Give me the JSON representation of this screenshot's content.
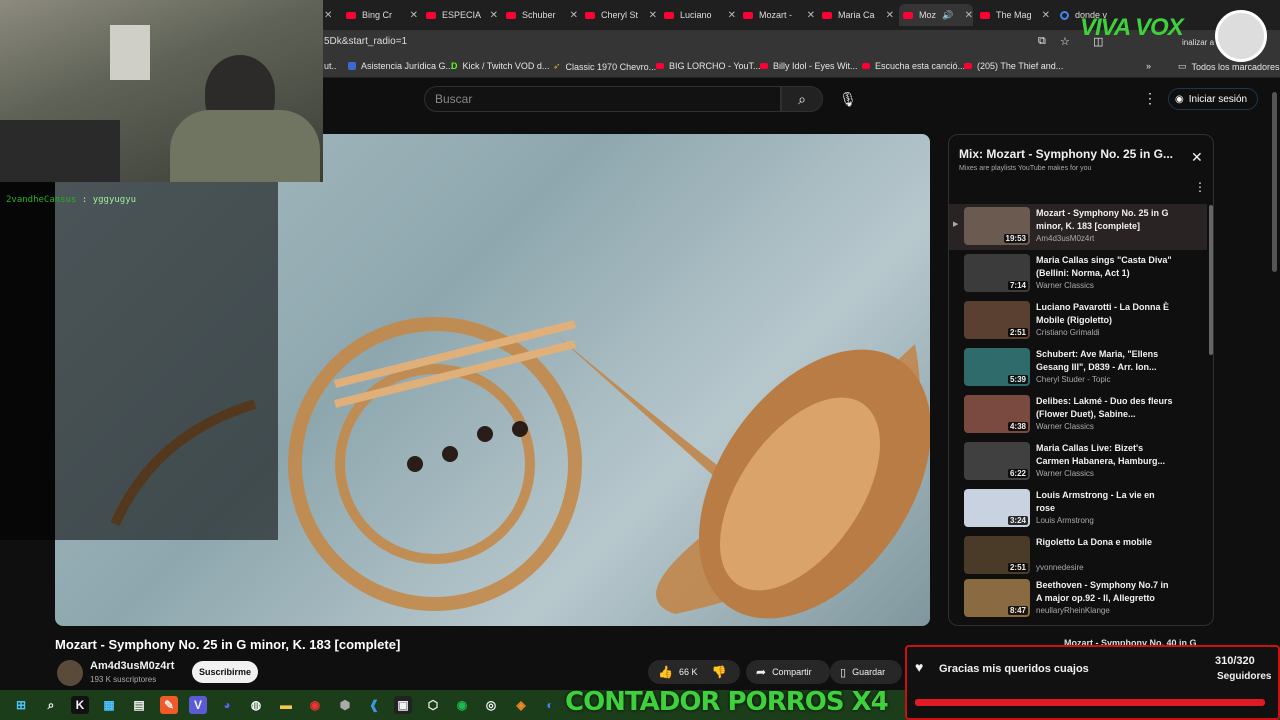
{
  "tabs": [
    {
      "label": "Bing Cr",
      "active": false
    },
    {
      "label": "ESPECIA",
      "active": false
    },
    {
      "label": "Schuber",
      "active": false
    },
    {
      "label": "Cheryl St",
      "active": false
    },
    {
      "label": "Luciano",
      "active": false
    },
    {
      "label": "Mozart -",
      "active": false
    },
    {
      "label": "Maria Ca",
      "active": false
    },
    {
      "label": "Moz",
      "active": true
    },
    {
      "label": "The Mag",
      "active": false
    },
    {
      "label": "donde v",
      "active": false
    }
  ],
  "url": "5Dk&start_radio=1",
  "bookmarks": [
    "ut..",
    "Asistencia Jurídica G...",
    "Kick / Twitch VOD d...",
    "Classic 1970 Chevro...",
    "BIG LORCHO - YouT...",
    "Billy Idol - Eyes Wit...",
    "Escucha esta canció...",
    "(205) The Thief and..."
  ],
  "all_bookmarks": "Todos los marcadores",
  "finalize": "inalizar a",
  "search": {
    "placeholder": "Buscar"
  },
  "signin_label": "Iniciar sesión",
  "video": {
    "title": "Mozart - Symphony No. 25 in G minor, K. 183 [complete]",
    "channel": "Am4d3usM0z4rt",
    "subscribers": "193 K suscriptores",
    "subscribe_label": "Suscribirme",
    "likes": "66 K",
    "share_label": "Compartir",
    "save_label": "Guardar"
  },
  "playlist": {
    "title": "Mix: Mozart - Symphony No. 25 in G...",
    "subtitle": "Mixes are playlists YouTube makes for you",
    "items": [
      {
        "title": "Mozart - Symphony No. 25 in G minor, K. 183 [complete]",
        "channel": "Am4d3usM0z4rt",
        "duration": "19:53"
      },
      {
        "title": "Maria Callas sings \"Casta Diva\" (Bellini: Norma, Act 1)",
        "channel": "Warner Classics",
        "duration": "7:14"
      },
      {
        "title": "Luciano Pavarotti - La Donna È Mobile (Rigoletto)",
        "channel": "Cristiano Grimaldi",
        "duration": "2:51"
      },
      {
        "title": "Schubert: Ave Maria, \"Ellens Gesang III\", D839 - Arr. Ion...",
        "channel": "Cheryl Studer - Topic",
        "duration": "5:39"
      },
      {
        "title": "Delibes: Lakmé - Duo des fleurs (Flower Duet), Sabine...",
        "channel": "Warner Classics",
        "duration": "4:38"
      },
      {
        "title": "Maria Callas Live: Bizet's Carmen Habanera, Hamburg...",
        "channel": "Warner Classics",
        "duration": "6:22"
      },
      {
        "title": "Louis Armstrong - La vie en rose",
        "channel": "Louis Armstrong",
        "duration": "3:24"
      },
      {
        "title": "Rigoletto La Dona e mobile",
        "channel": "yvonnedesire",
        "duration": "2:51"
      },
      {
        "title": "Beethoven - Symphony No.7 in A major op.92 - II, Allegretto",
        "channel": "neullaryRheinKlange",
        "duration": "8:47"
      }
    ],
    "peek_title": "Mozart - Symphony No. 40 in G"
  },
  "chat": {
    "user": "2vandheCansus",
    "text": ": yggyugyu"
  },
  "overlay": {
    "brand": "VIVA VOX",
    "counter": "CONTADOR PORROS X4",
    "alert_text": "Gracias mis queridos cuajos",
    "followers_count": "310/320",
    "followers_label": "Seguidores",
    "followers_progress": 0.97
  },
  "colors": {
    "accent_green": "#3fd13c",
    "yt_red": "#ff0033",
    "alert_red": "#e01b24"
  }
}
